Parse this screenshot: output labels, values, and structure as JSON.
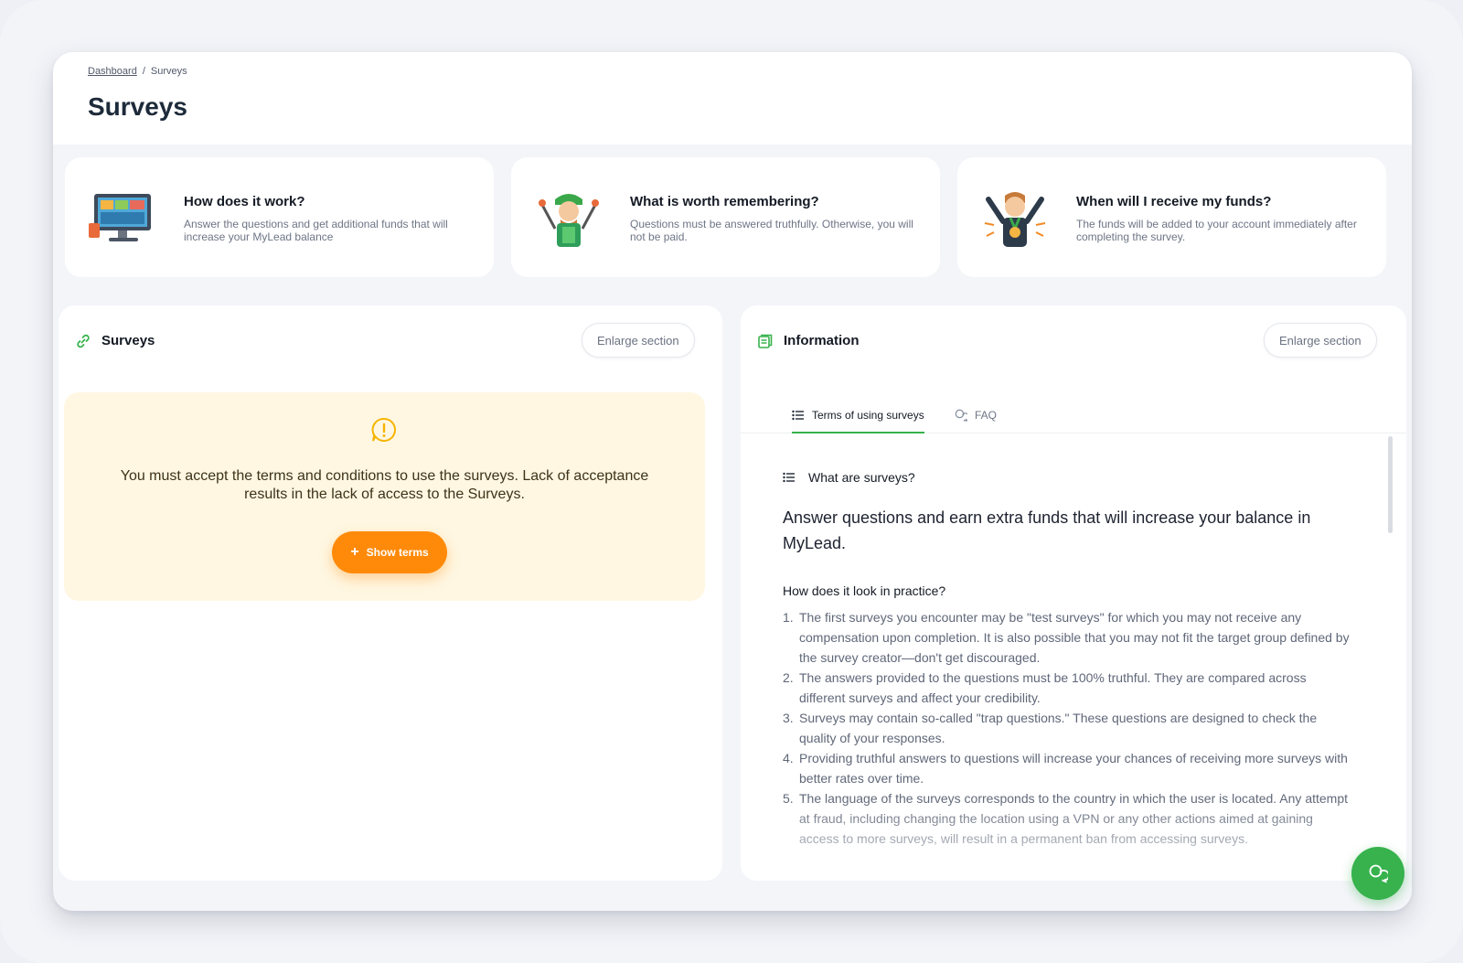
{
  "breadcrumb": {
    "home": "Dashboard",
    "separator": "/",
    "current": "Surveys"
  },
  "page_title": "Surveys",
  "info_cards": [
    {
      "title": "How does it work?",
      "description": "Answer the questions and get additional funds that will increase your MyLead balance",
      "icon": "monitor-illustration"
    },
    {
      "title": "What is worth remembering?",
      "description": "Questions must be answered truthfully. Otherwise, you will not be paid.",
      "icon": "worker-with-tools-illustration"
    },
    {
      "title": "When will I receive my funds?",
      "description": "The funds will be added to your account immediately after completing the survey.",
      "icon": "winner-with-medal-illustration"
    }
  ],
  "surveys_panel": {
    "title": "Surveys",
    "icon": "link-icon",
    "enlarge_label": "Enlarge section",
    "notice": {
      "icon": "alert-icon",
      "text": "You must accept the terms and conditions to use the surveys. Lack of acceptance results in the lack of access to the Surveys.",
      "button_label": "Show terms",
      "button_icon": "plus-icon"
    }
  },
  "info_panel": {
    "title": "Information",
    "icon": "document-icon",
    "enlarge_label": "Enlarge section",
    "tabs": [
      {
        "label": "Terms of using surveys",
        "icon": "list-icon",
        "active": true
      },
      {
        "label": "FAQ",
        "icon": "chat-icon",
        "active": false
      }
    ],
    "section_title": "What are surveys?",
    "lead": "Answer questions and earn extra funds that will increase your balance in MyLead.",
    "subheading": "How does it look in practice?",
    "rules": [
      "The first surveys you encounter may be \"test surveys\" for which you may not receive any compensation upon completion. It is also possible that you may not fit the target group defined by the survey creator—don't get discouraged.",
      "The answers provided to the questions must be 100% truthful. They are compared across different surveys and affect your credibility.",
      "Surveys may contain so-called \"trap questions.\" These questions are designed to check the quality of your responses.",
      "Providing truthful answers to questions will increase your chances of receiving more surveys with better rates over time.",
      "The language of the surveys corresponds to the country in which the user is located. Any attempt at fraud, including changing the location using a VPN or any other actions aimed at gaining access to more surveys, will result in a permanent ban from accessing surveys."
    ]
  },
  "colors": {
    "accent_green": "#37b24d",
    "accent_orange": "#ff8a0a",
    "notice_bg": "#fff7e2"
  },
  "chat_button_icon": "chat-bubbles-icon"
}
